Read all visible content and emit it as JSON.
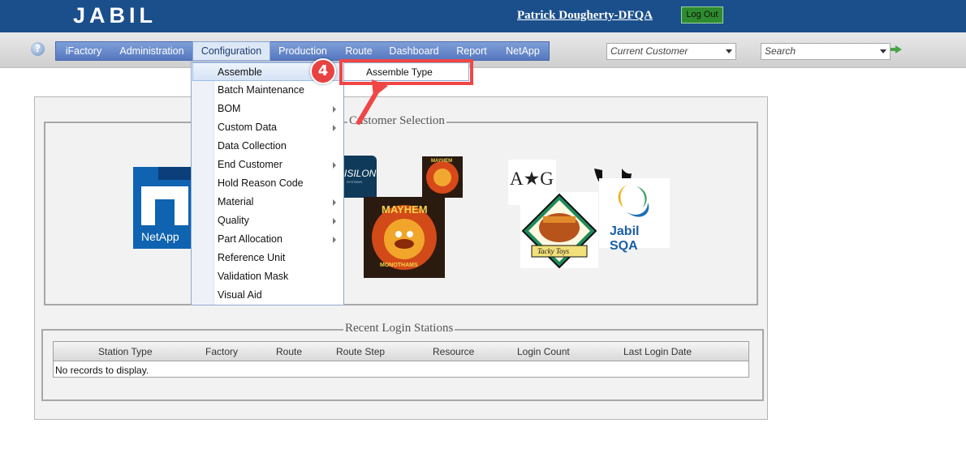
{
  "header": {
    "logo": "JABIL",
    "user_link": "Patrick Dougherty-DFQA",
    "logout_label": "Log Out"
  },
  "nav": {
    "help_icon": "?",
    "items": [
      "iFactory",
      "Administration",
      "Configuration",
      "Production",
      "Route",
      "Dashboard",
      "Report",
      "NetApp"
    ],
    "active": "Configuration"
  },
  "toolbar": {
    "customer_placeholder": "Current Customer",
    "search_placeholder": "Search"
  },
  "customer_selection": {
    "legend": "Customer Selection",
    "logos": {
      "netapp": "NetApp",
      "isilon": "ISILON",
      "isilon_sub": "SYSTEMS",
      "mayhem_small": "MAYHEM",
      "mayhem_large": "MAYHEM",
      "mayhem_large_sub": "MONOTHAMS",
      "ag": "A★G",
      "tacky": "Tacky Toys",
      "jabil_sqa": "Jabil SQA"
    }
  },
  "recent_logins": {
    "legend": "Recent Login Stations",
    "columns": [
      "Station Type",
      "Factory",
      "Route",
      "Route Step",
      "Resource",
      "Login Count",
      "Last Login Date"
    ],
    "empty_text": "No records to display."
  },
  "configuration_menu": {
    "items": [
      {
        "label": "Assemble",
        "submenu": false
      },
      {
        "label": "Batch Maintenance",
        "submenu": false
      },
      {
        "label": "BOM",
        "submenu": true
      },
      {
        "label": "Custom Data",
        "submenu": true
      },
      {
        "label": "Data Collection",
        "submenu": false
      },
      {
        "label": "End Customer",
        "submenu": true
      },
      {
        "label": "Hold Reason Code",
        "submenu": false
      },
      {
        "label": "Material",
        "submenu": true
      },
      {
        "label": "Quality",
        "submenu": true
      },
      {
        "label": "Part Allocation",
        "submenu": true
      },
      {
        "label": "Reference Unit",
        "submenu": false
      },
      {
        "label": "Validation Mask",
        "submenu": false
      },
      {
        "label": "Visual Aid",
        "submenu": false
      }
    ],
    "selected": "Assemble",
    "flyout_item": "Assemble Type"
  },
  "annotation": {
    "step_number": "4",
    "color": "#f04646"
  }
}
